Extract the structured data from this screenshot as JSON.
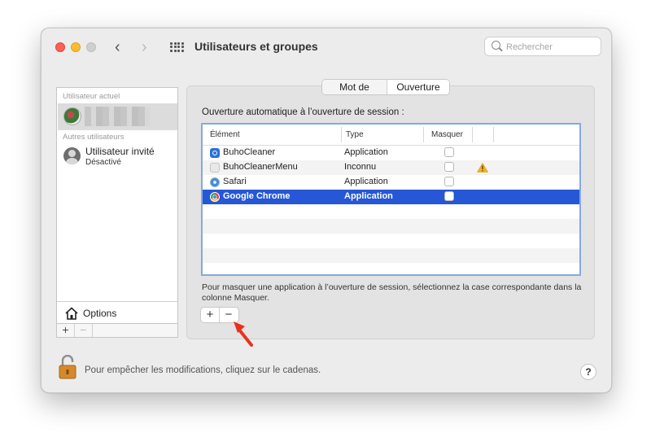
{
  "window": {
    "title": "Utilisateurs et groupes",
    "search_placeholder": "Rechercher"
  },
  "sidebar": {
    "current_user_header": "Utilisateur actuel",
    "other_users_header": "Autres utilisateurs",
    "guest": {
      "name": "Utilisateur invité",
      "status": "Désactivé"
    },
    "options_label": "Options",
    "add_label": "+",
    "remove_label": "−"
  },
  "tabs": [
    {
      "label": "Mot de passe",
      "active": false
    },
    {
      "label": "Ouverture",
      "active": true
    }
  ],
  "login_items": {
    "heading": "Ouverture automatique à l’ouverture de session :",
    "columns": {
      "element": "Élément",
      "type": "Type",
      "hide": "Masquer"
    },
    "rows": [
      {
        "name": "BuhoCleaner",
        "type": "Application",
        "icon": "buhocleaner-icon",
        "hidden": false,
        "warning": false,
        "selected": false
      },
      {
        "name": "BuhoCleanerMenu",
        "type": "Inconnu",
        "icon": "generic-app-icon",
        "hidden": false,
        "warning": true,
        "selected": false
      },
      {
        "name": "Safari",
        "type": "Application",
        "icon": "safari-icon",
        "hidden": false,
        "warning": false,
        "selected": false
      },
      {
        "name": "Google Chrome",
        "type": "Application",
        "icon": "chrome-icon",
        "hidden": false,
        "warning": false,
        "selected": true
      }
    ],
    "help_text": "Pour masquer une application à l’ouverture de session, sélectionnez la case correspondante dans la colonne Masquer.",
    "add_label": "+",
    "remove_label": "−"
  },
  "footer": {
    "lock_text": "Pour empêcher les modifications, cliquez sur le cadenas.",
    "help_label": "?"
  },
  "colors": {
    "selection": "#2557d6",
    "focus_ring": "#86a8e6",
    "annotation_arrow": "#e8321e",
    "warning": "#f2b321"
  }
}
